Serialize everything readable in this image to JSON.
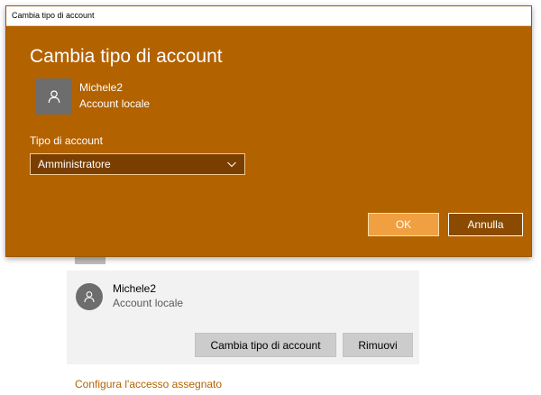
{
  "dialog": {
    "window_title": "Cambia tipo di account",
    "heading": "Cambia tipo di account",
    "user": {
      "name": "Michele2",
      "account_type": "Account locale",
      "avatar_icon": "person-icon"
    },
    "field_label": "Tipo di account",
    "select": {
      "selected": "Amministratore",
      "chevron_icon": "chevron-down-icon"
    },
    "ok_label": "OK",
    "cancel_label": "Annulla"
  },
  "background_page": {
    "account_card": {
      "name": "Michele2",
      "account_type": "Account locale",
      "avatar_icon": "person-icon",
      "change_button": "Cambia tipo di account",
      "remove_button": "Rimuovi"
    },
    "assigned_access_link": "Configura l'accesso assegnato"
  },
  "colors": {
    "accent": "#b36200",
    "link": "#b36400",
    "button_primary": "#f0a040"
  }
}
